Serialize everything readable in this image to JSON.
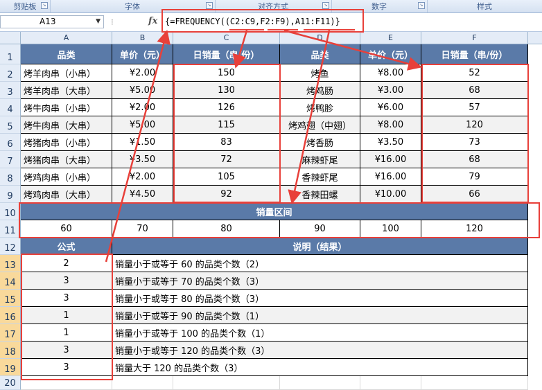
{
  "ribbon": {
    "groups": [
      {
        "label": "剪贴板"
      },
      {
        "label": "字体"
      },
      {
        "label": "对齐方式"
      },
      {
        "label": "数字"
      },
      {
        "label": "样式"
      }
    ]
  },
  "formula_bar": {
    "name_box": "A13",
    "fx_label": "fx",
    "formula": "{=FREQUENCY((C2:C9,F2:F9),A11:F11)}"
  },
  "columns": [
    "A",
    "B",
    "C",
    "D",
    "E",
    "F"
  ],
  "rows": [
    "1",
    "2",
    "3",
    "4",
    "5",
    "6",
    "7",
    "8",
    "9",
    "10",
    "11",
    "12",
    "13",
    "14",
    "15",
    "16",
    "17",
    "18",
    "19",
    "20"
  ],
  "table": {
    "headers": [
      "品类",
      "单价（元）",
      "日销量（串/份）",
      "品类",
      "单价（元）",
      "日销量（串/份）"
    ],
    "data": [
      [
        "烤羊肉串（小串）",
        "¥2.00",
        "150",
        "烤鱼",
        "¥8.00",
        "52"
      ],
      [
        "烤羊肉串（大串）",
        "¥5.00",
        "130",
        "烤鸡肠",
        "¥3.00",
        "68"
      ],
      [
        "烤牛肉串（小串）",
        "¥2.00",
        "126",
        "烤鸭胗",
        "¥6.00",
        "57"
      ],
      [
        "烤牛肉串（大串）",
        "¥5.00",
        "115",
        "烤鸡翅（中翅）",
        "¥8.00",
        "120"
      ],
      [
        "烤猪肉串（小串）",
        "¥1.50",
        "83",
        "烤香肠",
        "¥3.50",
        "73"
      ],
      [
        "烤猪肉串（大串）",
        "¥3.50",
        "72",
        "麻辣虾尾",
        "¥16.00",
        "68"
      ],
      [
        "烤鸡肉串（小串）",
        "¥2.00",
        "105",
        "香辣虾尾",
        "¥16.00",
        "79"
      ],
      [
        "烤鸡肉串（大串）",
        "¥4.50",
        "92",
        "香辣田螺",
        "¥10.00",
        "66"
      ]
    ],
    "bins_title": "销量区间",
    "bins": [
      "60",
      "70",
      "80",
      "90",
      "100",
      "120"
    ],
    "result_headers": [
      "公式",
      "说明（结果）"
    ],
    "results": [
      [
        "2",
        "销量小于或等于 60 的品类个数（2）"
      ],
      [
        "3",
        "销量小于或等于 70 的品类个数（3）"
      ],
      [
        "3",
        "销量小于或等于 80 的品类个数（3）"
      ],
      [
        "1",
        "销量小于或等于 90 的品类个数（1）"
      ],
      [
        "1",
        "销量小于或等于 100 的品类个数（1）"
      ],
      [
        "3",
        "销量小于或等于 120 的品类个数（3）"
      ],
      [
        "3",
        "销量大于 120 的品类个数（3）"
      ]
    ]
  },
  "colors": {
    "header_fill": "#5a7aa8",
    "highlight_red": "#e8403a",
    "selected_row_header": "#f9d99b"
  }
}
